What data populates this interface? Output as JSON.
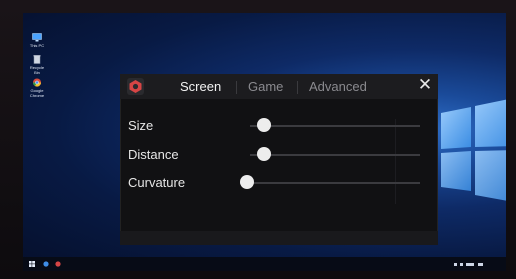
{
  "desktop": {
    "icons": [
      {
        "label": "This PC",
        "icon": "computer-icon"
      },
      {
        "label": "Recycle Bin",
        "icon": "recycle-bin-icon"
      },
      {
        "label": "Google Chrome",
        "icon": "chrome-icon"
      }
    ],
    "taskbar": {
      "items": [
        "windows-start-icon",
        "search-icon",
        "app-icon"
      ]
    }
  },
  "dialog": {
    "app_icon": "app-logo-icon",
    "tabs": [
      {
        "label": "Screen",
        "active": true
      },
      {
        "label": "Game",
        "active": false
      },
      {
        "label": "Advanced",
        "active": false
      }
    ],
    "close_label": "✕",
    "settings": [
      {
        "label": "Size",
        "value_fraction": 0.04
      },
      {
        "label": "Distance",
        "value_fraction": 0.04
      },
      {
        "label": "Curvature",
        "value_fraction": 0.0
      }
    ]
  },
  "colors": {
    "accent": "#d64545",
    "active_tab": "#f2f2f2",
    "inactive_tab": "#8a8a8f"
  }
}
